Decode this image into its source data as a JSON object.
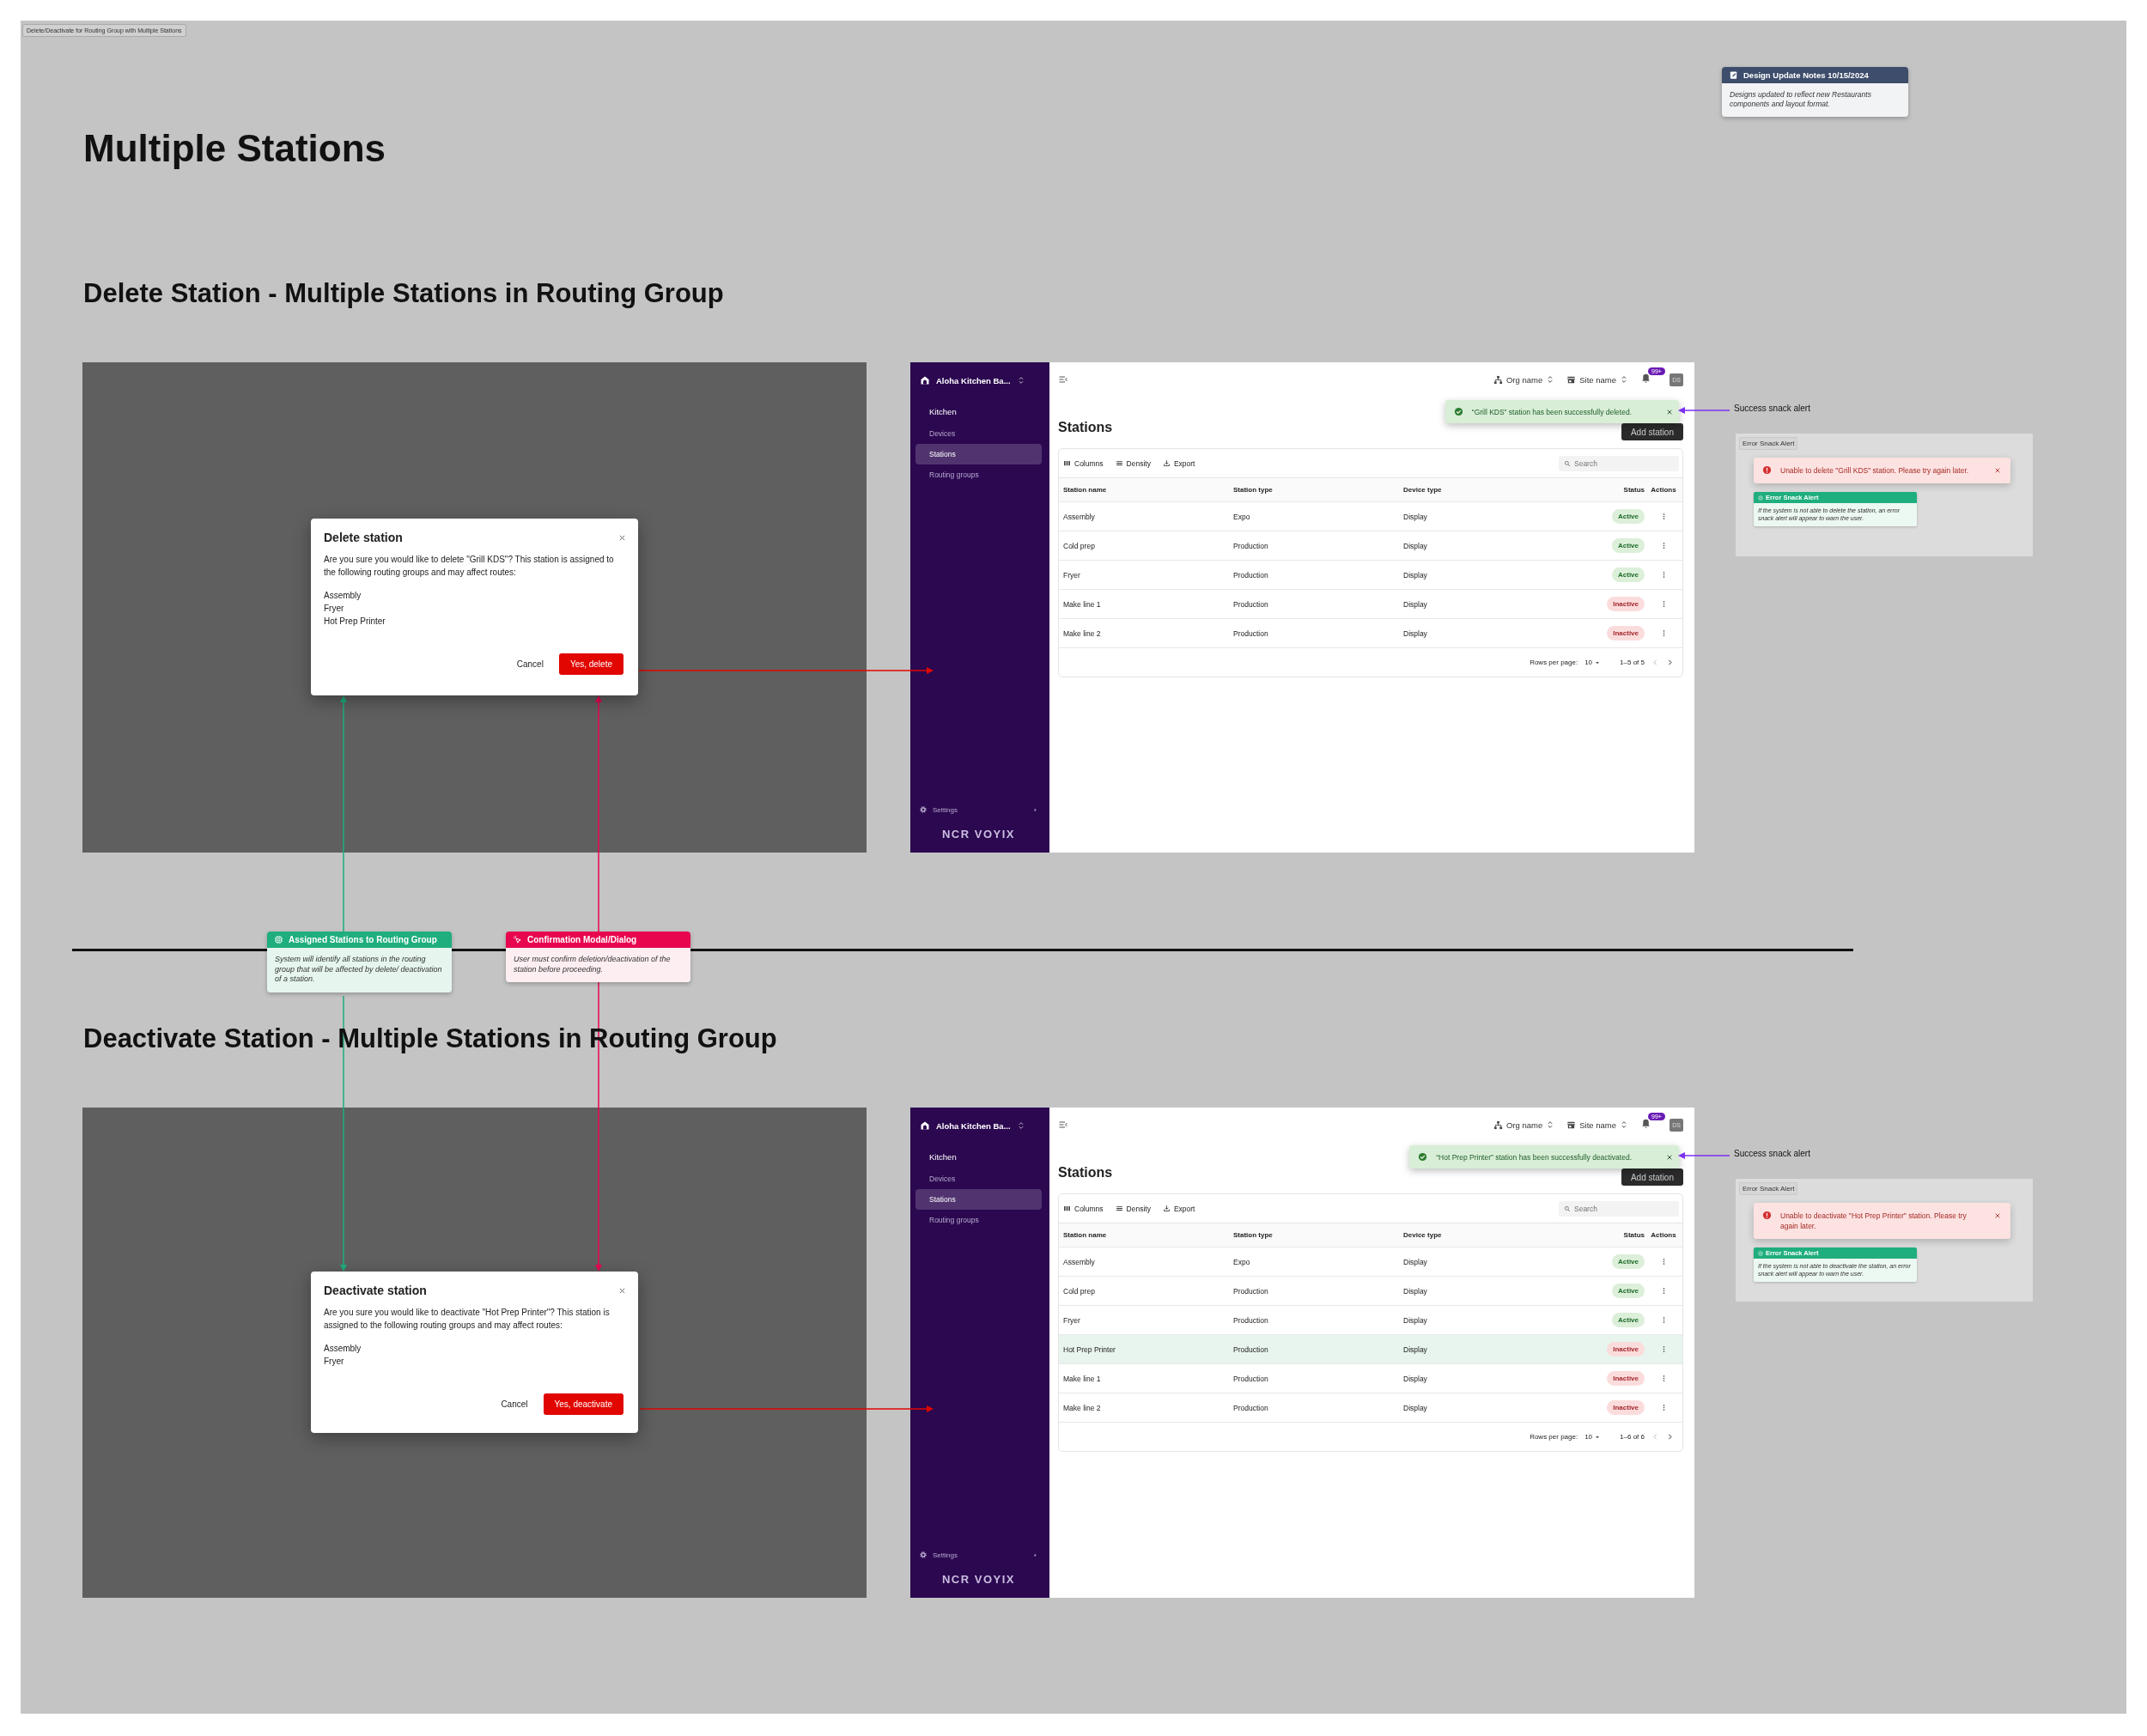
{
  "page_label": "Delete/Deactivate for Routing Group with Multiple Stations",
  "title": "Multiple Stations",
  "notes": {
    "title": "Design Update Notes 10/15/2024",
    "body": "Designs updated to reflect new Restaurants components and layout format."
  },
  "sections": [
    {
      "heading": "Delete Station - Multiple Stations in Routing Group",
      "dialog": {
        "title": "Delete station",
        "message": "Are you sure you would like to delete \"Grill KDS\"? This station is assigned to the following routing groups and may affect routes:",
        "stations": [
          "Assembly",
          "Fryer",
          "Hot Prep Printer"
        ],
        "cancel": "Cancel",
        "confirm": "Yes, delete"
      },
      "app": {
        "brand": "Aloha Kitchen Ba...",
        "section": "Kitchen",
        "nav": [
          {
            "label": "Devices",
            "selected": false
          },
          {
            "label": "Stations",
            "selected": true
          },
          {
            "label": "Routing groups",
            "selected": false
          }
        ],
        "settings": "Settings",
        "logo": "NCR VOYIX",
        "org": "Org name",
        "site": "Site name",
        "badge": "99+",
        "avatar": "DS",
        "page_title": "Stations",
        "add_button": "Add station",
        "snack": "“Grill KDS” station has been successfully deleted.",
        "toolbar": [
          "Columns",
          "Density",
          "Export"
        ],
        "search_placeholder": "Search",
        "columns": [
          "Station name",
          "Station type",
          "Device type",
          "Status",
          "Actions"
        ],
        "rows": [
          {
            "cells": [
              "Assembly",
              "Expo",
              "Display"
            ],
            "status": {
              "label": "Active",
              "kind": "active"
            },
            "highlighted": false
          },
          {
            "cells": [
              "Cold prep",
              "Production",
              "Display"
            ],
            "status": {
              "label": "Active",
              "kind": "active"
            },
            "highlighted": false
          },
          {
            "cells": [
              "Fryer",
              "Production",
              "Display"
            ],
            "status": {
              "label": "Active",
              "kind": "active"
            },
            "highlighted": false
          },
          {
            "cells": [
              "Make line 1",
              "Production",
              "Display"
            ],
            "status": {
              "label": "Inactive",
              "kind": "inactive"
            },
            "highlighted": false
          },
          {
            "cells": [
              "Make line 2",
              "Production",
              "Display"
            ],
            "status": {
              "label": "Inactive",
              "kind": "inactive"
            },
            "highlighted": false
          }
        ],
        "rows_per_page_label": "Rows per page:",
        "rows_per_page": "10",
        "range": "1–5 of 5"
      },
      "success_label": "Success snack alert",
      "error_panel": {
        "tag": "Error Snack Alert",
        "message": "Unable to delete \"Grill KDS\" station. Please try again later.",
        "note_title": "Error Snack Alert",
        "note_body": "If the system is not able to delete the station, an error snack alert will appear to warn the user."
      }
    },
    {
      "heading": "Deactivate Station - Multiple Stations in Routing Group",
      "dialog": {
        "title": "Deactivate station",
        "message": "Are you sure you would like to deactivate \"Hot Prep Printer\"? This station is assigned to the following routing groups and may affect routes:",
        "stations": [
          "Assembly",
          "Fryer"
        ],
        "cancel": "Cancel",
        "confirm": "Yes, deactivate"
      },
      "app": {
        "brand": "Aloha Kitchen Ba...",
        "section": "Kitchen",
        "nav": [
          {
            "label": "Devices",
            "selected": false
          },
          {
            "label": "Stations",
            "selected": true
          },
          {
            "label": "Routing groups",
            "selected": false
          }
        ],
        "settings": "Settings",
        "logo": "NCR VOYIX",
        "org": "Org name",
        "site": "Site name",
        "badge": "99+",
        "avatar": "DS",
        "page_title": "Stations",
        "add_button": "Add station",
        "snack": "“Hot Prep Printer” station has been successfully deactivated.",
        "toolbar": [
          "Columns",
          "Density",
          "Export"
        ],
        "search_placeholder": "Search",
        "columns": [
          "Station name",
          "Station type",
          "Device type",
          "Status",
          "Actions"
        ],
        "rows": [
          {
            "cells": [
              "Assembly",
              "Expo",
              "Display"
            ],
            "status": {
              "label": "Active",
              "kind": "active"
            },
            "highlighted": false
          },
          {
            "cells": [
              "Cold prep",
              "Production",
              "Display"
            ],
            "status": {
              "label": "Active",
              "kind": "active"
            },
            "highlighted": false
          },
          {
            "cells": [
              "Fryer",
              "Production",
              "Display"
            ],
            "status": {
              "label": "Active",
              "kind": "active"
            },
            "highlighted": false
          },
          {
            "cells": [
              "Hot Prep Printer",
              "Production",
              "Display"
            ],
            "status": {
              "label": "Inactive",
              "kind": "inactive"
            },
            "highlighted": true
          },
          {
            "cells": [
              "Make line 1",
              "Production",
              "Display"
            ],
            "status": {
              "label": "Inactive",
              "kind": "inactive"
            },
            "highlighted": false
          },
          {
            "cells": [
              "Make line 2",
              "Production",
              "Display"
            ],
            "status": {
              "label": "Inactive",
              "kind": "inactive"
            },
            "highlighted": false
          }
        ],
        "rows_per_page_label": "Rows per page:",
        "rows_per_page": "10",
        "range": "1–6 of 6"
      },
      "success_label": "Success snack alert",
      "error_panel": {
        "tag": "Error Snack Alert",
        "message": "Unable to deactivate \"Hot Prep Printer\" station. Please try again later.",
        "note_title": "Error Snack Alert",
        "note_body": "If the system is not able to deactivate the station, an error snack alert will appear to warn the user."
      }
    }
  ],
  "annotations": [
    {
      "kind": "assigned",
      "title": "Assigned Stations to Routing Group",
      "body": "System will identify all stations in the routing group that will be affected by delete/ deactivation of a station.",
      "color": "#1fae7d"
    },
    {
      "kind": "confirm",
      "title": "Confirmation Modal/Dialog",
      "body": "User must confirm deletion/deactivation of the station before proceeding.",
      "color": "#e8064f"
    }
  ]
}
